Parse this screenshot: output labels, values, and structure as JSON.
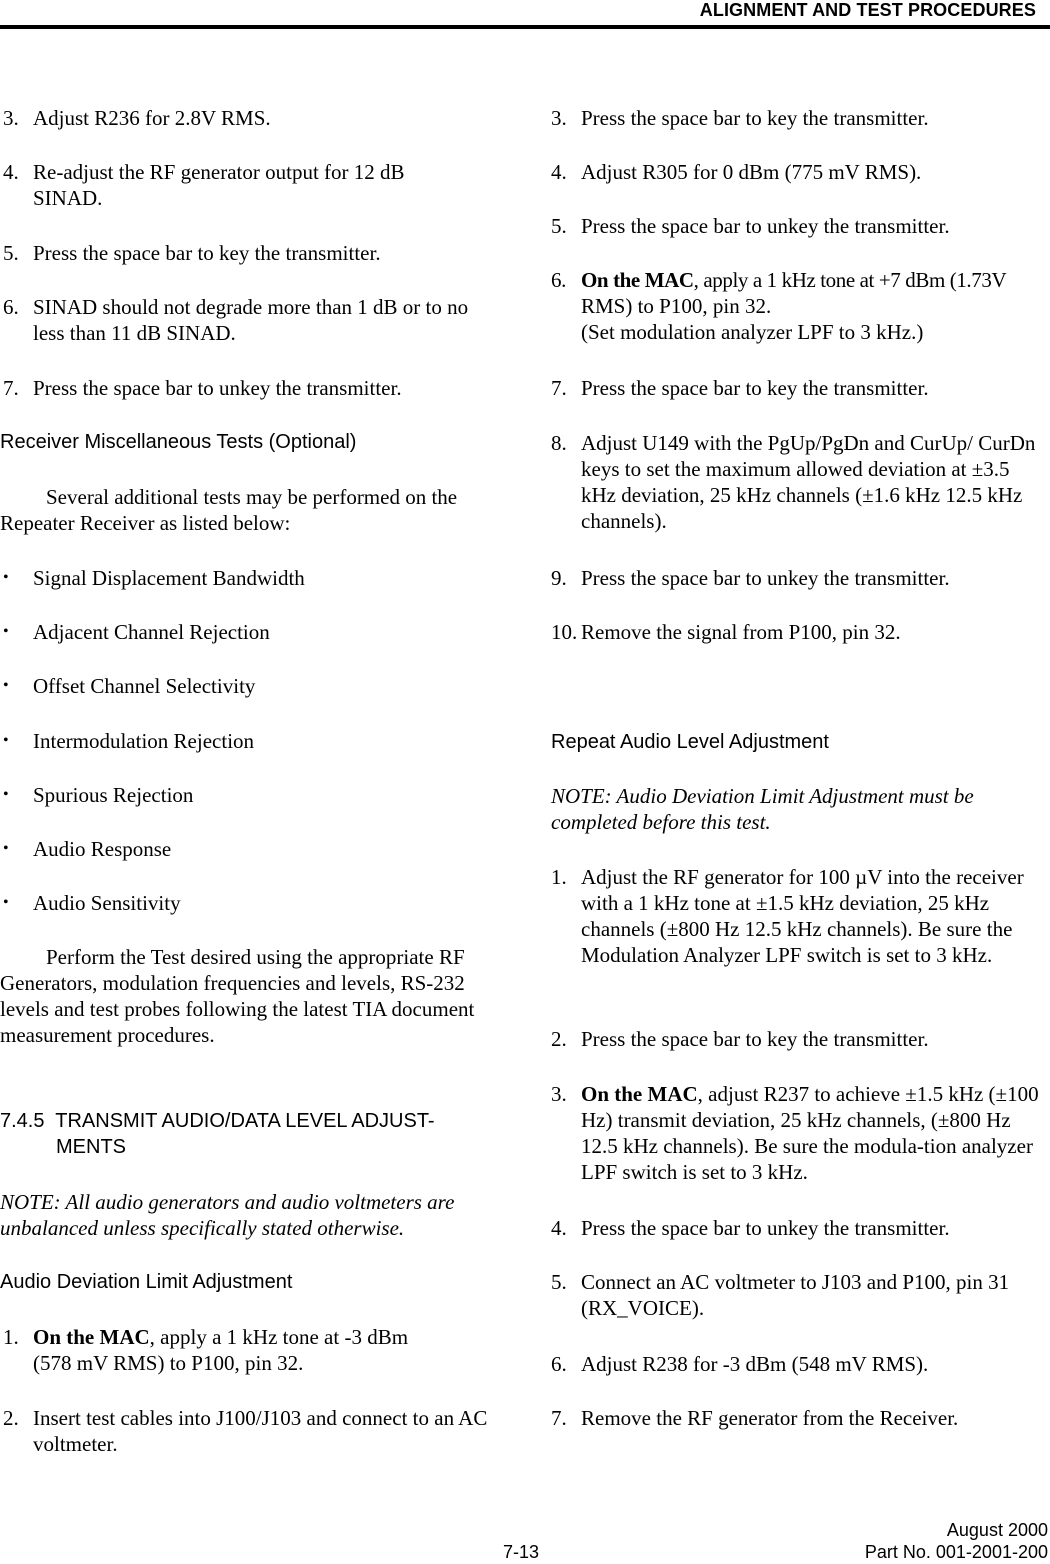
{
  "header": {
    "title": "ALIGNMENT AND TEST PROCEDURES"
  },
  "left": {
    "steps_top": [
      {
        "num": "3.",
        "text": "Adjust R236 for 2.8V RMS."
      },
      {
        "num": "4.",
        "text": "Re-adjust the RF generator output for 12 dB SINAD."
      },
      {
        "num": "5.",
        "text": "Press the space bar to key the transmitter."
      },
      {
        "num": "6.",
        "text": "SINAD should not degrade more than 1 dB or to no less than 11 dB SINAD."
      },
      {
        "num": "7.",
        "text": "Press the space bar to unkey the transmitter."
      }
    ],
    "misc_heading": "Receiver Miscellaneous Tests (Optional)",
    "misc_intro": "Several additional tests may be performed on the Repeater Receiver as listed below:",
    "bullet": "•",
    "misc_tests": [
      "Signal Displacement Bandwidth",
      "Adjacent Channel Rejection",
      "Offset Channel Selectivity",
      "Intermodulation Rejection",
      "Spurious Rejection",
      "Audio Response",
      "Audio Sensitivity"
    ],
    "perform_text": "Perform the Test desired using the appropriate RF Generators, modulation frequencies and levels, RS-232 levels and test probes following the latest TIA document measurement procedures.",
    "section_num": "7.4.5",
    "section_title_line1": "TRANSMIT AUDIO/DATA LEVEL ADJUST-",
    "section_title_line2": "MENTS",
    "note": "NOTE: All audio generators and audio voltmeters are unbalanced unless specifically stated otherwise.",
    "adl_heading": "Audio Deviation Limit Adjustment",
    "adl_steps": [
      {
        "num": "1.",
        "bold": "On the MAC",
        "line1": ", apply a 1 kHz tone at -3 dBm",
        "line2": "(578 mV RMS) to P100, pin 32."
      },
      {
        "num": "2.",
        "text": "Insert test cables into J100/J103 and connect to an AC voltmeter."
      }
    ]
  },
  "right": {
    "steps": [
      {
        "num": "3.",
        "text": "Press the space bar to key the transmitter."
      },
      {
        "num": "4.",
        "text": "Adjust R305 for 0 dBm (775 mV RMS)."
      },
      {
        "num": "5.",
        "text": "Press the space bar to unkey the transmitter."
      },
      {
        "num": "6.",
        "bold": "On the MAC",
        "line1": ", apply a 1 kHz tone at +7 dBm (1.73V",
        "line2": "RMS) to P100, pin 32.",
        "line3": "(Set modulation analyzer LPF to 3 kHz.)"
      },
      {
        "num": "7.",
        "text": "Press the space bar to key the transmitter."
      },
      {
        "num": "8.",
        "text": "Adjust U149 with the PgUp/PgDn and CurUp/ CurDn keys to set the maximum allowed deviation at ±3.5 kHz deviation, 25 kHz channels (±1.6 kHz 12.5 kHz channels)."
      },
      {
        "num": "9.",
        "text": "Press the space bar to unkey the transmitter."
      },
      {
        "num": "10.",
        "text": "Remove the signal from P100, pin 32."
      }
    ],
    "repeat_heading": "Repeat Audio Level Adjustment",
    "repeat_note": "NOTE: Audio Deviation Limit Adjustment must be completed before this test.",
    "repeat_steps": [
      {
        "num": "1.",
        "text": "Adjust the RF generator for 100 µV into the receiver with a 1 kHz tone at ±1.5 kHz deviation, 25 kHz channels (±800 Hz 12.5 kHz channels). Be sure the Modulation Analyzer LPF switch is set to 3 kHz."
      },
      {
        "num": "2.",
        "text": "Press the space bar to key the transmitter."
      },
      {
        "num": "3.",
        "bold": "On the MAC",
        "text": ", adjust R237 to achieve ±1.5 kHz (±100 Hz) transmit deviation, 25 kHz channels, (±800 Hz 12.5 kHz channels).  Be sure the modula-tion analyzer LPF switch is set to 3 kHz."
      },
      {
        "num": "4.",
        "text": "Press the space bar to unkey the transmitter."
      },
      {
        "num": "5.",
        "text": "Connect an AC voltmeter to J103 and P100, pin 31 (RX_VOICE)."
      },
      {
        "num": "6.",
        "text": "Adjust R238 for -3 dBm (548 mV RMS)."
      },
      {
        "num": "7.",
        "text": "Remove the RF generator from the Receiver."
      }
    ]
  },
  "footer": {
    "page": "7-13",
    "date": "August 2000",
    "part": "Part No. 001-2001-200"
  }
}
